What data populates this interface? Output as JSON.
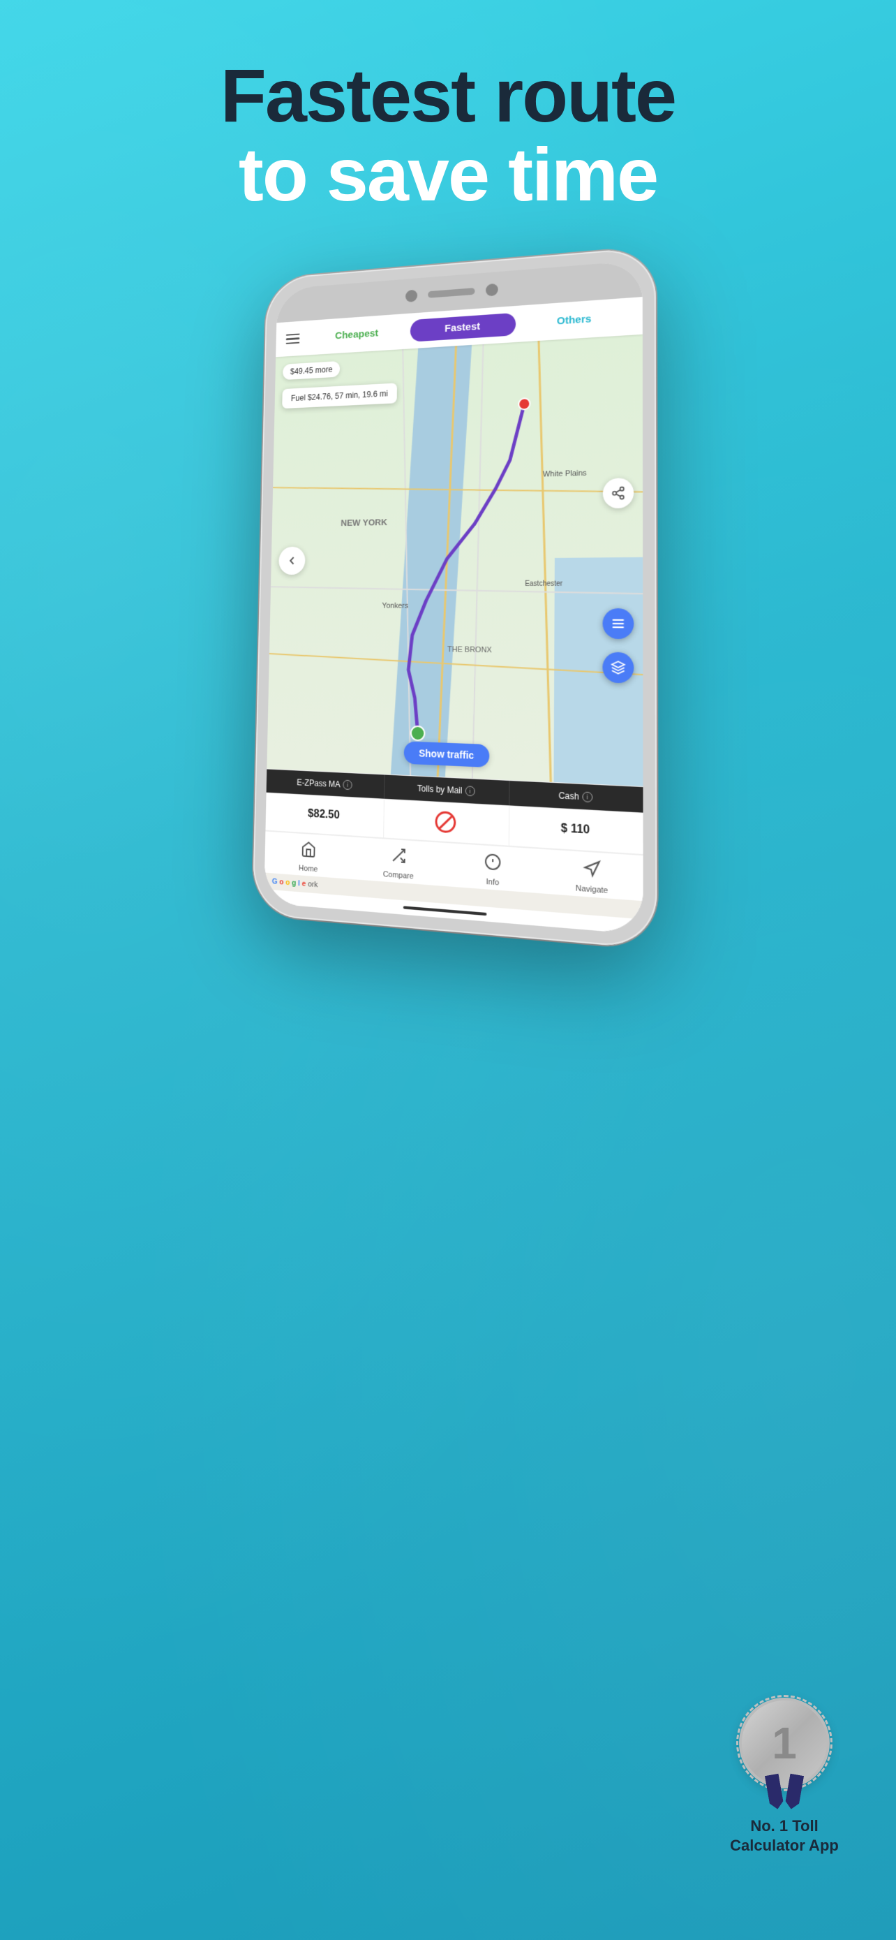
{
  "hero": {
    "line1": "Fastest route",
    "line2": "to save time"
  },
  "tabs": {
    "cheapest": "Cheapest",
    "fastest": "Fastest",
    "others": "Others"
  },
  "map": {
    "price_more": "$49.45 more",
    "fuel_info": "Fuel $24.76, 57 min, 19.6 mi",
    "show_traffic": "Show traffic",
    "labels": {
      "new_york": "NEW YORK",
      "yonkers": "Yonkers",
      "bronx": "THE BRONX",
      "white_plains": "White Plains",
      "eastchester": "Eastchester"
    }
  },
  "payment": {
    "col1_label": "E-ZPass MA",
    "col2_label": "Tolls by Mail",
    "col3_label": "Cash",
    "col1_value": "$82.50",
    "col2_value": "—",
    "col3_value": "$ 110"
  },
  "nav": {
    "home": "Home",
    "compare": "Compare",
    "info": "Info",
    "navigate": "Navigate"
  },
  "award": {
    "number": "1",
    "line1": "No. 1 Toll",
    "line2": "Calculator App"
  }
}
